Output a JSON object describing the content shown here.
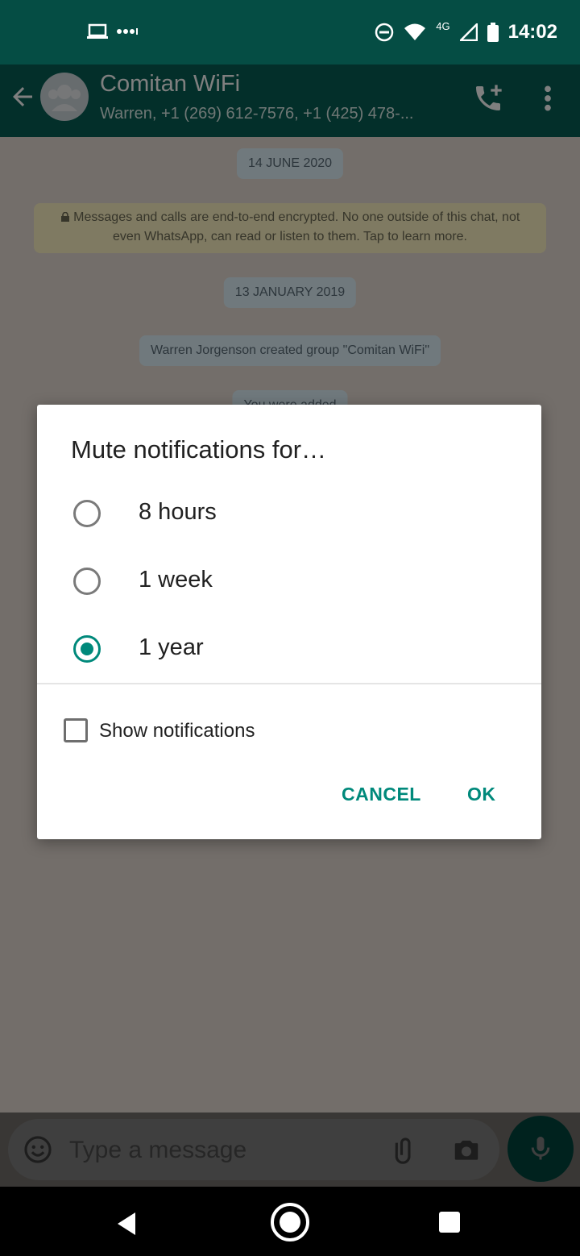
{
  "status_bar": {
    "time": "14:02",
    "network_label": "4G",
    "left_icons": [
      "laptop-icon",
      "dots-icon"
    ],
    "right_icons": [
      "dnd-icon",
      "wifi-icon",
      "signal-icon",
      "battery-icon"
    ]
  },
  "app_bar": {
    "title": "Comitan WiFi",
    "subtitle": "Warren, +1 (269) 612-7576, +1 (425) 478-..."
  },
  "chat": {
    "date_1": "14 JUNE 2020",
    "encryption_notice": "Messages and calls are end-to-end encrypted. No one outside of this chat, not even WhatsApp, can read or listen to them. Tap to learn more.",
    "date_2": "13 JANUARY 2019",
    "system_message": "Warren Jorgenson created group \"Comitan WiFi\"",
    "partial_message": "You were added"
  },
  "composer": {
    "placeholder": "Type a message"
  },
  "dialog": {
    "title": "Mute notifications for…",
    "options": [
      {
        "label": "8 hours",
        "selected": false
      },
      {
        "label": "1 week",
        "selected": false
      },
      {
        "label": "1 year",
        "selected": true
      }
    ],
    "checkbox_label": "Show notifications",
    "checkbox_checked": false,
    "cancel_label": "CANCEL",
    "ok_label": "OK"
  },
  "colors": {
    "accent": "#00897b",
    "app_bar": "#075e54",
    "status_bar": "#054d44"
  }
}
